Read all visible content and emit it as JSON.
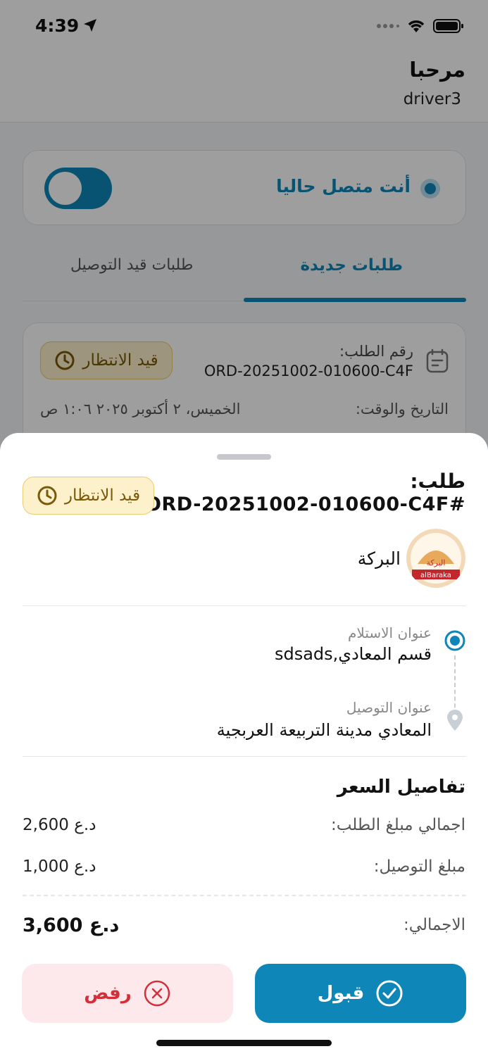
{
  "status_bar": {
    "time": "4:39"
  },
  "header": {
    "greeting": "مرحبا",
    "username": "driver3"
  },
  "online_card": {
    "label": "أنت متصل حاليا",
    "toggle_on": true
  },
  "tabs": {
    "new_orders": "طلبات جديدة",
    "in_delivery": "طلبات قيد التوصيل"
  },
  "bg_order": {
    "order_label": "رقم الطلب:",
    "order_number": "ORD-20251002-010600-C4F",
    "status": "قيد الانتظار",
    "datetime_label": "التاريخ والوقت:",
    "datetime_value": "الخميس، ٢ أكتوبر ٢٠٢٥ ١:٠٦ ص"
  },
  "sheet": {
    "title": "طلب:",
    "order_number": "ORD-20251002-010600-C4F#",
    "status": "قيد الانتظار",
    "store": {
      "name": "البركة",
      "logo_text": "alBaraka",
      "logo_arabic": "البركة"
    },
    "pickup": {
      "label": "عنوان الاستلام",
      "address": "قسم المعادي,sdsads"
    },
    "dropoff": {
      "label": "عنوان التوصيل",
      "address": "المعادي مدينة التربيعة العربجية"
    },
    "price": {
      "title": "تفاصيل السعر",
      "subtotal_label": "اجمالي مبلغ الطلب:",
      "subtotal_value": "2,600 د.ع",
      "delivery_label": "مبلغ التوصيل:",
      "delivery_value": "1,000 د.ع",
      "total_label": "الاجمالي:",
      "total_value": "3,600 د.ع"
    },
    "accept_label": "قبول",
    "reject_label": "رفض"
  },
  "colors": {
    "primary": "#0f86b8",
    "pending_bg": "#fdf1cc",
    "reject": "#d32f3a"
  }
}
